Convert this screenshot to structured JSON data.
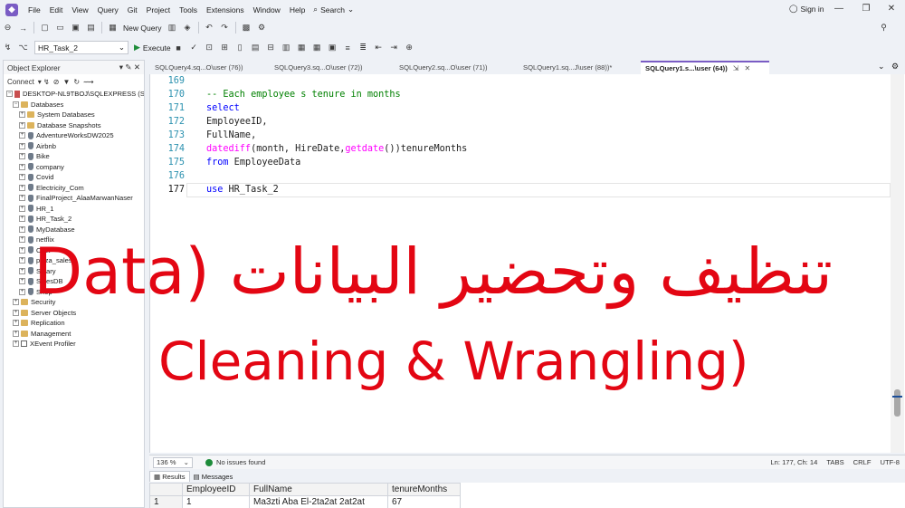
{
  "menu": {
    "items": [
      "File",
      "Edit",
      "View",
      "Query",
      "Git",
      "Project",
      "Tools",
      "Extensions",
      "Window",
      "Help"
    ],
    "search_label": "Search",
    "sign_in": "Sign in"
  },
  "toolbar": {
    "new_query": "New Query",
    "database": "HR_Task_2",
    "execute": "Execute"
  },
  "object_explorer": {
    "title": "Object Explorer",
    "connect": "Connect",
    "server": "DESKTOP-NL9TBOJ\\SQLEXPRESS (SQL",
    "databases_label": "Databases",
    "db_folders": [
      "System Databases",
      "Database Snapshots"
    ],
    "databases": [
      "AdventureWorksDW2025",
      "Airbnb",
      "Bike",
      "company",
      "Covid",
      "Electricity_Com",
      "FinalProject_AlaaMarwanNaser",
      "HR_1",
      "HR_Task_2",
      "MyDatabase",
      "netflix",
      "Olist",
      "pizza_sales",
      "Salary",
      "SalesDB",
      "Shop"
    ],
    "server_folders": [
      "Security",
      "Server Objects",
      "Replication",
      "Management"
    ],
    "xevent": "XEvent Profiler"
  },
  "tabs": [
    {
      "label": "SQLQuery4.sq...O\\user (76))",
      "active": false
    },
    {
      "label": "SQLQuery3.sq...O\\user (72))",
      "active": false
    },
    {
      "label": "SQLQuery2.sq...O\\user (71))",
      "active": false
    },
    {
      "label": "SQLQuery1.sq...J\\user (88))*",
      "active": false
    },
    {
      "label": "SQLQuery1.s...\\user (64))",
      "active": true
    }
  ],
  "editor": {
    "line_numbers": [
      "169",
      "170",
      "171",
      "172",
      "173",
      "174",
      "175",
      "176",
      "177"
    ],
    "code": {
      "l170": "-- Each employee s tenure in months",
      "l171": "select",
      "l172": "EmployeeID,",
      "l173": "FullName,",
      "l174_fn1": "datediff",
      "l174_a": "(month, HireDate,",
      "l174_fn2": "getdate",
      "l174_b": "())tenureMonths",
      "l175_kw": "from",
      "l175_rest": " EmployeeData",
      "l177_kw": "use",
      "l177_rest": " HR_Task_2"
    }
  },
  "overlay": {
    "arabic": "تنظيف وتحضير البيانات (Data",
    "english": "Cleaning & Wrangling)"
  },
  "status": {
    "zoom": "136 %",
    "issues": "No issues found",
    "position": "Ln: 177, Ch: 14",
    "tabs": "TABS",
    "line_ending": "CRLF",
    "encoding": "UTF-8"
  },
  "results": {
    "tab_results": "Results",
    "tab_messages": "Messages",
    "columns": [
      "EmployeeID",
      "FullName",
      "tenureMonths"
    ],
    "rows": [
      [
        "1",
        "1",
        "Ma3zti Aba El-2ta2at 2at2at",
        "67"
      ]
    ]
  },
  "colors": {
    "accent": "#7a5cc4",
    "overlay_text": "#e30613",
    "keyword": "#0000ff",
    "function": "#ff00ff",
    "comment": "#008000",
    "line_number": "#2b91af"
  }
}
